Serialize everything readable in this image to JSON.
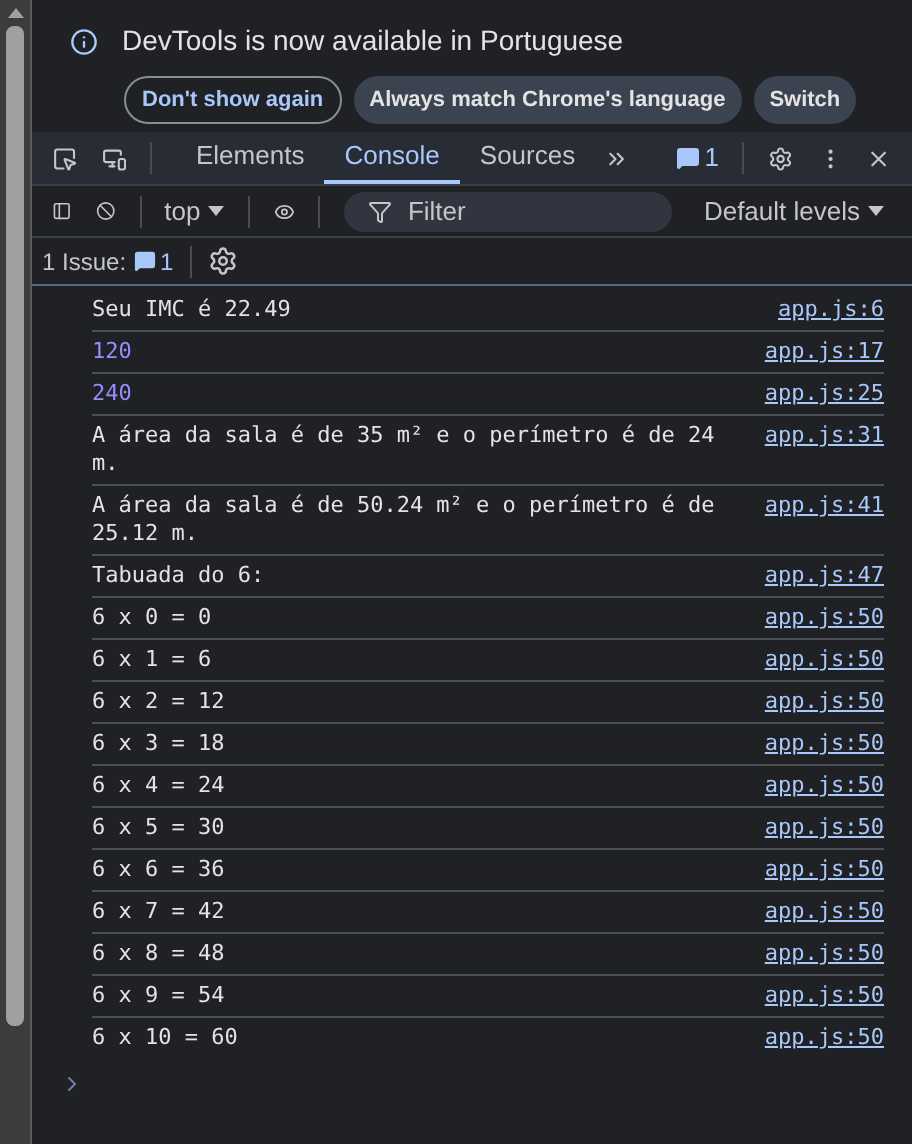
{
  "banner": {
    "message": "DevTools is now available in Portuguese",
    "buttons": [
      {
        "label": "Don't show again",
        "kind": "outline"
      },
      {
        "label": "Always match Chrome's language",
        "kind": "filled"
      },
      {
        "label": "Switch",
        "kind": "filled"
      }
    ]
  },
  "tabs": [
    {
      "label": "Elements",
      "selected": false
    },
    {
      "label": "Console",
      "selected": true
    },
    {
      "label": "Sources",
      "selected": false
    }
  ],
  "message_badge": "1",
  "console_toolbar": {
    "context": "top",
    "filter_placeholder": "Filter",
    "levels": "Default levels"
  },
  "issues": {
    "label": "1 Issue:",
    "count": "1"
  },
  "messages": [
    {
      "text": "Seu IMC é 22.49",
      "kind": "text",
      "source": "app.js:6"
    },
    {
      "text": "120",
      "kind": "number",
      "source": "app.js:17"
    },
    {
      "text": "240",
      "kind": "number",
      "source": "app.js:25"
    },
    {
      "text": "A área da sala é de 35 m² e o perímetro é de 24 m.",
      "kind": "text",
      "source": "app.js:31"
    },
    {
      "text": "A área da sala é de 50.24 m² e o perímetro é de 25.12 m.",
      "kind": "text",
      "source": "app.js:41"
    },
    {
      "text": "Tabuada do 6:",
      "kind": "text",
      "source": "app.js:47"
    },
    {
      "text": "6 x 0 = 0",
      "kind": "text",
      "source": "app.js:50"
    },
    {
      "text": "6 x 1 = 6",
      "kind": "text",
      "source": "app.js:50"
    },
    {
      "text": "6 x 2 = 12",
      "kind": "text",
      "source": "app.js:50"
    },
    {
      "text": "6 x 3 = 18",
      "kind": "text",
      "source": "app.js:50"
    },
    {
      "text": "6 x 4 = 24",
      "kind": "text",
      "source": "app.js:50"
    },
    {
      "text": "6 x 5 = 30",
      "kind": "text",
      "source": "app.js:50"
    },
    {
      "text": "6 x 6 = 36",
      "kind": "text",
      "source": "app.js:50"
    },
    {
      "text": "6 x 7 = 42",
      "kind": "text",
      "source": "app.js:50"
    },
    {
      "text": "6 x 8 = 48",
      "kind": "text",
      "source": "app.js:50"
    },
    {
      "text": "6 x 9 = 54",
      "kind": "text",
      "source": "app.js:50"
    },
    {
      "text": "6 x 10 = 60",
      "kind": "text",
      "source": "app.js:50"
    }
  ]
}
